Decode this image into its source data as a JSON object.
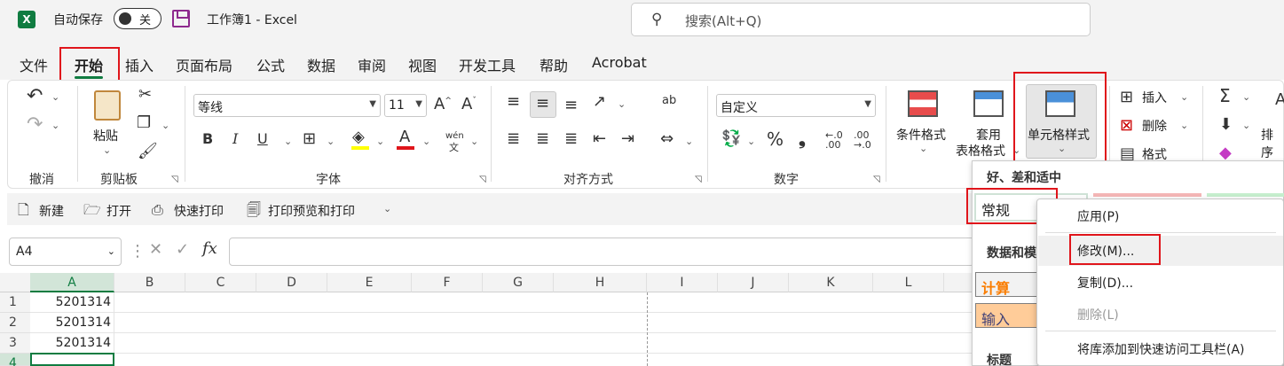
{
  "titlebar": {
    "app_logo": "excel-logo",
    "autosave_label": "自动保存",
    "autosave_state": "关",
    "doc_title": "工作簿1  -  Excel",
    "search_placeholder": "搜索(Alt+Q)"
  },
  "tabs": [
    "文件",
    "开始",
    "插入",
    "页面布局",
    "公式",
    "数据",
    "审阅",
    "视图",
    "开发工具",
    "帮助",
    "Acrobat"
  ],
  "active_tab": "开始",
  "ribbon": {
    "undo_group": "撤消",
    "clipboard": {
      "paste": "粘贴",
      "label": "剪贴板"
    },
    "font": {
      "name": "等线",
      "size": "11",
      "label": "字体",
      "bold": "B",
      "italic": "I",
      "underline": "U",
      "phonetic": "wén",
      "phonetic_char": "文",
      "grow": "A^",
      "shrink": "Aˇ"
    },
    "alignment": {
      "label": "对齐方式",
      "wrap": "ab"
    },
    "number": {
      "format": "自定义",
      "label": "数字",
      "percent": "%",
      "comma": "❟"
    },
    "styles": {
      "conditional": "条件格式",
      "table_top": "套用",
      "table_bottom": "表格格式",
      "cell_styles": "单元格样式"
    },
    "cells": {
      "insert": "插入",
      "delete": "删除",
      "format": "格式"
    },
    "editing": {
      "sort": "排序"
    }
  },
  "quickbar": {
    "new": "新建",
    "open": "打开",
    "quick_print": "快速打印",
    "print_preview": "打印预览和打印"
  },
  "formula_bar": {
    "name_box": "A4",
    "fx": "fx",
    "formula": ""
  },
  "grid": {
    "columns": [
      "A",
      "B",
      "C",
      "D",
      "E",
      "F",
      "G",
      "H",
      "I",
      "J",
      "K",
      "L"
    ],
    "rows": [
      "1",
      "2",
      "3",
      "4"
    ],
    "cells": [
      "5201314",
      "5201314",
      "5201314",
      ""
    ],
    "active_cell": "A4"
  },
  "gallery": {
    "section_good_bad": "好、差和适中",
    "normal": "常规",
    "section_data_model": "数据和模",
    "calc": "计算",
    "input": "输入",
    "section_title": "标题"
  },
  "context_menu": {
    "apply": "应用(P)",
    "modify": "修改(M)...",
    "duplicate": "复制(D)...",
    "delete": "删除(L)",
    "add_to_qat": "将库添加到快速访问工具栏(A)"
  },
  "colors": {
    "excel_green": "#107c41",
    "highlight_red": "#e0151b",
    "calc_orange": "#fa7d00",
    "input_fill": "#ffcc99"
  }
}
